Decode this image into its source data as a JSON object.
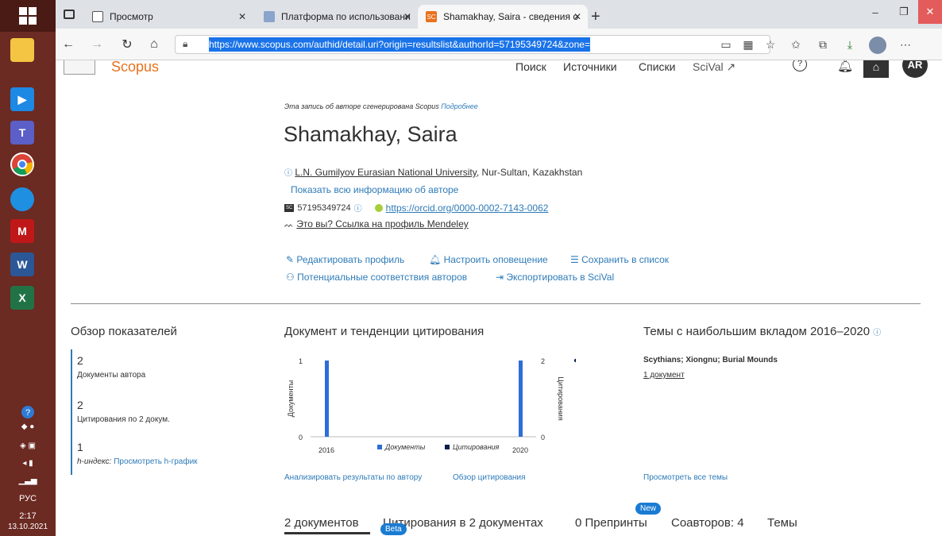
{
  "browser": {
    "tabs": [
      {
        "label": "Просмотр"
      },
      {
        "label": "Платформа по использованию"
      },
      {
        "label": "Shamakhay, Saira - сведения об"
      }
    ],
    "url": "https://www.scopus.com/authid/detail.uri?origin=resultslist&authorId=57195349724&zone="
  },
  "taskbar": {
    "lang": "РУС",
    "time": "2:17",
    "date": "13.10.2021"
  },
  "site": {
    "logo": "Scopus",
    "nav": [
      "Поиск",
      "Источники",
      "Списки",
      "SciVal ↗"
    ],
    "avatar": "AR"
  },
  "author": {
    "generated_note": "Эта запись об авторе сгенерирована Scopus",
    "more_link": "Подробнее",
    "name": "Shamakhay, Saira",
    "affiliation_link": "L.N. Gumilyov Eurasian National University",
    "affiliation_rest": ", Nur-Sultan, Kazakhstan",
    "show_all": "Показать всю информацию об авторе",
    "scopus_id": "57195349724",
    "orcid": "https://orcid.org/0000-0002-7143-0062",
    "mendeley": "Это вы? Ссылка на профиль Mendeley"
  },
  "actions": {
    "edit": "Редактировать профиль",
    "alert": "Настроить оповещение",
    "save": "Сохранить в список",
    "matches": "Потенциальные соответствия авторов",
    "export": "Экспортировать в SciVal"
  },
  "metrics": {
    "title": "Обзор показателей",
    "docs_num": "2",
    "docs_label": "Документы автора",
    "cites_num": "2",
    "cites_label": "Цитирования по 2 докум.",
    "h_num": "1",
    "h_label": "h-индекс:",
    "h_link": "Просмотреть h-график"
  },
  "trends": {
    "title": "Документ и тенденции цитирования",
    "analyze": "Анализировать результаты по автору",
    "cite_overview": "Обзор цитирования"
  },
  "chart_data": {
    "type": "bar",
    "x": [
      2016,
      2020
    ],
    "xlabels": [
      "2016",
      "2020"
    ],
    "series": [
      {
        "name": "Документы",
        "type": "bar",
        "axis": "left",
        "values": [
          1,
          1
        ],
        "color": "#2d6dd8"
      },
      {
        "name": "Цитирования",
        "type": "scatter",
        "axis": "right",
        "values": [
          0,
          2
        ],
        "color": "#0b1e4a"
      }
    ],
    "ylabel_left": "Документы",
    "ylabel_right": "Цитирования",
    "yticks_left": [
      "1",
      "0"
    ],
    "yticks_right": [
      "2",
      "0"
    ],
    "ylim_left": [
      0,
      1
    ],
    "ylim_right": [
      0,
      2
    ]
  },
  "topics": {
    "title": "Темы с наибольшим вкладом 2016–2020",
    "topic": "Scythians; Xiongnu; Burial Mounds",
    "doc_count": "1 документ",
    "view_all": "Просмотреть все темы"
  },
  "bottom_tabs": {
    "docs": "2 документов",
    "cites": "Цитирования в 2 документах",
    "preprints": "0 Препринты",
    "coauthors": "Соавторов: 4",
    "topics": "Темы",
    "beta": "Beta",
    "new": "New"
  }
}
